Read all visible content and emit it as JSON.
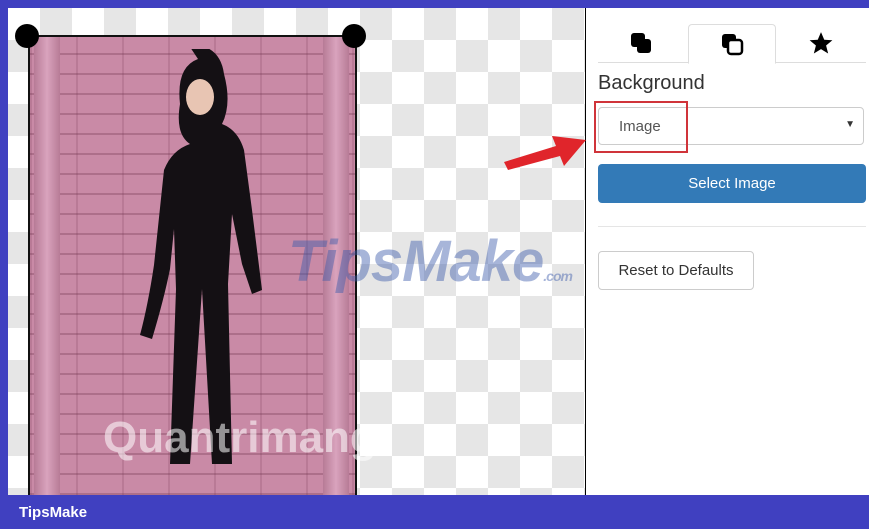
{
  "panel": {
    "tabs": [
      {
        "icon": "layers-icon"
      },
      {
        "icon": "copy-icon"
      },
      {
        "icon": "star-icon"
      }
    ],
    "background_label": "Background",
    "background_select": {
      "value": "Image"
    },
    "select_image_label": "Select Image",
    "reset_label": "Reset to Defaults"
  },
  "watermarks": {
    "brand": "TipsMake",
    "brand_suffix": ".com",
    "secondary": "Quantrimang"
  },
  "footer": {
    "text": "TipsMake"
  },
  "colors": {
    "primary": "#337ab7",
    "annotation": "#d0343a",
    "frame": "#4040c0"
  }
}
